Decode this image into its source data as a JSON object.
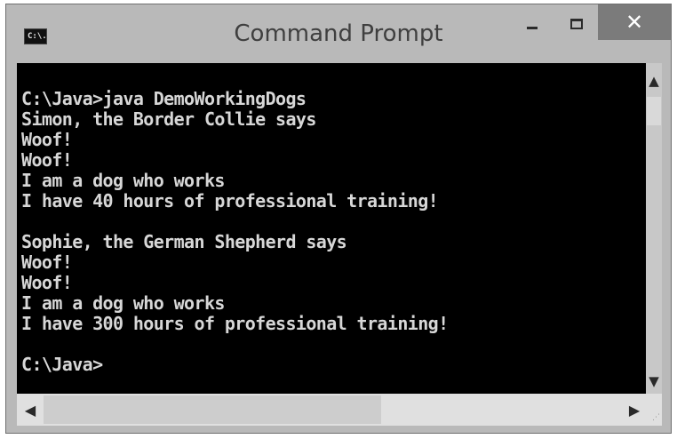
{
  "window": {
    "title": "Command Prompt",
    "icon": "console-app-icon",
    "icon_text": "C:\\.",
    "controls": {
      "minimize": "minimize-icon",
      "maximize": "maximize-icon",
      "close_label": "✕"
    }
  },
  "console": {
    "lines": [
      "C:\\Java>java DemoWorkingDogs",
      "Simon, the Border Collie says",
      "Woof!",
      "Woof!",
      "I am a dog who works",
      "I have 40 hours of professional training!",
      "",
      "Sophie, the German Shepherd says",
      "Woof!",
      "Woof!",
      "I am a dog who works",
      "I have 300 hours of professional training!",
      "",
      "C:\\Java>"
    ]
  },
  "scrollbars": {
    "vertical": {
      "up": "▲",
      "down": "▼",
      "up_icon": "chevron-up-icon",
      "down_icon": "chevron-down-icon"
    },
    "horizontal": {
      "left": "◀",
      "right": "▶",
      "left_icon": "chevron-left-icon",
      "right_icon": "chevron-right-icon"
    }
  },
  "colors": {
    "console_bg": "#000000",
    "console_text": "#d7d7d7",
    "titlebar": "#b9b9b9",
    "close_button": "#7b7b7b"
  }
}
